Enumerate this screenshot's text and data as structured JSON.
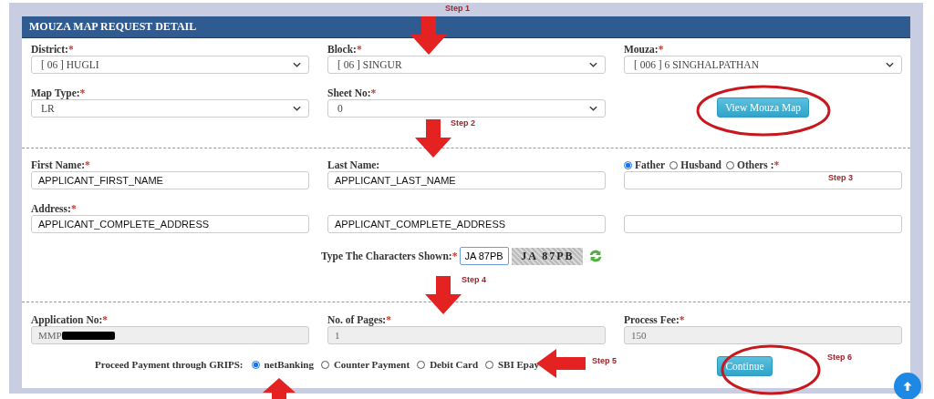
{
  "panel": {
    "title": "MOUZA MAP REQUEST DETAIL"
  },
  "location": [
    {
      "label": "District:",
      "mark": "*",
      "value": "[ 06 ] HUGLI"
    },
    {
      "label": "Block:",
      "mark": "*",
      "value": "[ 06 ] SINGUR"
    },
    {
      "label": "Mouza:",
      "mark": "*",
      "value": "[ 006 ] 6 SINGHALPATHAN"
    },
    {
      "label": "Map Type:",
      "mark": "*",
      "value": "LR"
    },
    {
      "label": "Sheet No:",
      "mark": "*",
      "value": "0"
    }
  ],
  "view_button": "View Mouza Map",
  "first_name": {
    "label": "First Name:",
    "mark": "*",
    "value": "APPLICANT_FIRST_NAME"
  },
  "last_name": {
    "label": "Last Name:",
    "value": "APPLICANT_LAST_NAME"
  },
  "relation": {
    "options": [
      {
        "label": "Father",
        "selected": true
      },
      {
        "label": "Husband",
        "selected": false
      },
      {
        "label": "Others :",
        "selected": false
      }
    ],
    "mark": "*"
  },
  "address": {
    "label": "Address:",
    "mark": "*",
    "lines": [
      "APPLICANT_COMPLETE_ADDRESS",
      "APPLICANT_COMPLETE_ADDRESS"
    ]
  },
  "captcha": {
    "label": "Type The Characters Shown:",
    "mark": "*",
    "value": "JA 87PB",
    "image_text": "JA 87PB"
  },
  "application_no": {
    "label": "Application No:",
    "mark": "*",
    "value": "MMP"
  },
  "pages": {
    "label": "No. of Pages:",
    "mark": "*",
    "value": "1"
  },
  "fee": {
    "label": "Process Fee:",
    "mark": "*",
    "value": "150"
  },
  "payment": {
    "label": "Proceed Payment through GRIPS:",
    "options": [
      {
        "label": "netBanking",
        "selected": true
      },
      {
        "label": "Counter Payment",
        "selected": false
      },
      {
        "label": "Debit Card",
        "selected": false
      },
      {
        "label": "SBI Epay",
        "selected": false
      }
    ]
  },
  "continue_button": "Continue",
  "annotations": [
    {
      "kind": "arrow",
      "label": "Step 1"
    },
    {
      "kind": "arrow",
      "label": "Step 2"
    },
    {
      "kind": "note",
      "label": "Step 3"
    },
    {
      "kind": "arrow",
      "label": "Step 4"
    },
    {
      "kind": "arrow",
      "label": "Step 5"
    },
    {
      "kind": "note",
      "label": "Step 6"
    }
  ]
}
